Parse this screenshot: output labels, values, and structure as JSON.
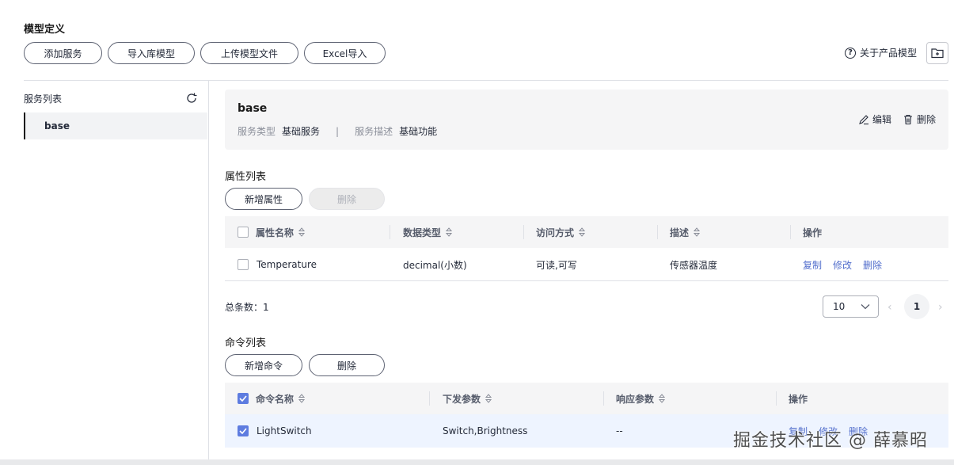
{
  "page": {
    "title": "模型定义"
  },
  "toolbar": {
    "add_service": "添加服务",
    "import_library": "导入库模型",
    "upload_model": "上传模型文件",
    "excel_import": "Excel导入",
    "about_model": "关于产品模型",
    "help_glyph": "?"
  },
  "sidebar": {
    "heading": "服务列表",
    "items": [
      {
        "label": "base"
      }
    ]
  },
  "service": {
    "name": "base",
    "type_label": "服务类型",
    "type_value": "基础服务",
    "separator": "|",
    "desc_label": "服务描述",
    "desc_value": "基础功能",
    "edit": "编辑",
    "delete": "删除"
  },
  "properties": {
    "title": "属性列表",
    "add_button": "新增属性",
    "delete_button": "删除",
    "columns": [
      "属性名称",
      "数据类型",
      "访问方式",
      "描述",
      "操作"
    ],
    "rows": [
      {
        "name": "Temperature",
        "type": "decimal(小数)",
        "access": "可读,可写",
        "desc": "传感器温度",
        "actions": [
          "复制",
          "修改",
          "删除"
        ],
        "checked": false
      }
    ]
  },
  "pagination": {
    "total_label": "总条数：1",
    "page_size": "10",
    "current_page": "1",
    "prev": "‹",
    "next": "›"
  },
  "commands": {
    "title": "命令列表",
    "add_button": "新增命令",
    "delete_button": "删除",
    "columns": [
      "命令名称",
      "下发参数",
      "响应参数",
      "操作"
    ],
    "rows": [
      {
        "name": "LightSwitch",
        "params": "Switch,Brightness",
        "response": "--",
        "actions": [
          "复制",
          "修改",
          "删除"
        ],
        "checked": true
      }
    ]
  },
  "watermark": "掘金技术社区 @ 薛慕昭",
  "colors": {
    "link": "#526ecc",
    "checkbox_on": "#5e7ce0",
    "selected_row": "#eef4ff"
  }
}
